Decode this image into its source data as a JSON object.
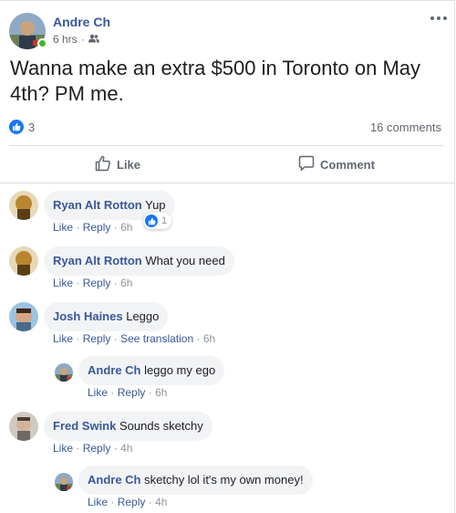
{
  "post": {
    "author": "Andre Ch",
    "time": "6 hrs",
    "text": "Wanna make an extra $500 in Toronto on May 4th? PM me.",
    "reaction_count": "3",
    "comments_count": "16 comments"
  },
  "actions": {
    "like_label": "Like",
    "comment_label": "Comment"
  },
  "comment_links": {
    "like": "Like",
    "reply": "Reply",
    "see_translation": "See translation"
  },
  "comments": [
    {
      "name": "Ryan Alt Rotton",
      "text": "Yup",
      "time": "6h",
      "reaction_count": "1"
    },
    {
      "name": "Ryan Alt Rotton",
      "text": "What you need",
      "time": "6h"
    },
    {
      "name": "Josh Haines",
      "text": "Leggo",
      "time": "6h"
    },
    {
      "name": "Andre Ch",
      "text": "leggo my ego",
      "time": "6h"
    },
    {
      "name": "Fred Swink",
      "text": "Sounds sketchy",
      "time": "4h"
    },
    {
      "name": "Andre Ch",
      "text": "sketchy lol it's my own money!",
      "time": "4h"
    }
  ],
  "colors": {
    "link": "#385898",
    "accent": "#1877f2",
    "online": "#42b72a",
    "bubble": "#f2f3f5"
  }
}
